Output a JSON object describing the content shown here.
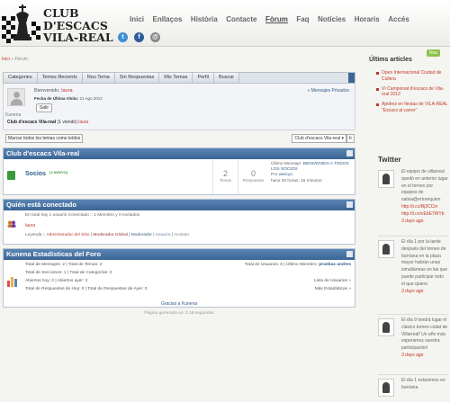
{
  "header": {
    "logo_line1": "CLUB",
    "logo_line2": "D'ESCACS",
    "logo_line3": "VILA-REAL",
    "nav": [
      "Inici",
      "Enllaços",
      "Història",
      "Contacte",
      "Fòrum",
      "Faq",
      "Notícies",
      "Horaris",
      "Accés"
    ],
    "social": [
      "t",
      "f",
      "@"
    ]
  },
  "breadcrumb": {
    "home": "Inici",
    "sep": "»",
    "current": "Fòrum"
  },
  "forum": {
    "tabs": [
      "Categories",
      "Temes Recients",
      "Nou Tema",
      "Sin Respuestas",
      "Mis Temas",
      "Perfil",
      "Buscar"
    ],
    "user": {
      "welcome": "Bienvenido,",
      "username": "laura",
      "last_visit_label": "Fecha de Última Visita:",
      "last_visit_value": "21 Ago 2012",
      "logout": "Salir",
      "private_messages": "» Mensajes Privados",
      "kunena": "Kunena",
      "viewing_prefix": "Club d'escacs Vila-real",
      "viewing_mid": "(1 viendo)",
      "viewing_user": "laura"
    },
    "toolbar": {
      "mark_all": "Marcar todos los temas como leídos",
      "select": "Club d'escacs Vila-real ▾",
      "go": "Ir"
    },
    "category": {
      "section_title": "Club d'escacs Vila-real",
      "name": "Socios",
      "new_badge": "(2 NUEVO)",
      "topics_num": "2",
      "topics_lbl": "Temas",
      "replies_num": "0",
      "replies_lbl": "Respuestas",
      "last_post_label": "Último Mensaje:",
      "last_post_title": "BIENVENIDA A TODOS LOS SOCIOS",
      "by_label": "Por",
      "by_user": "aescyo",
      "time_ago": "hace 20 horas, 15 minutos"
    },
    "online": {
      "section_title": "Quién está conectado",
      "summary": "En total hay 1 usuario Conectado  ::  1 Miembro y 0 Invitados",
      "user": "laura",
      "legend_label": "Leyenda ::",
      "legend_admin": "Administrador del Sitio",
      "legend_gmod": "Moderador Global",
      "legend_mod": "Moderador",
      "legend_user": "Usuario",
      "legend_guest": "Invitado"
    },
    "stats": {
      "section_title": "Kunena Estadísticas del Foro",
      "row1": "Total de Mensajes: 2  |  Total de Temas: 2",
      "row2": "Total de Secciones: 1  |  Total de Categorías: 2",
      "row3": "Abiertos hoy: 0  |  Abiertos ayer: 2",
      "row4": "Total de Respuestas de Hoy: 0  |  Total de Respuestas de Ayer: 0",
      "users_total": "Total de Usuarios: 6  |  Último Miembro:",
      "last_member": "pruebas andres",
      "user_list": "Lista de Usuarios »",
      "more_stats": "Más Estadísticas »"
    },
    "footer_credit": "Gracias a Kunena",
    "footer_time": "Página generada en: 0.18 segundos"
  },
  "sidebar": {
    "articles_title": "Últims articles",
    "new_badge": "Nou",
    "articles": [
      "Open Internacional Ciudad de Cullera",
      "VI Campionat d'escacs de Vila-real 2012",
      "Ajedrez en fiestas de VILA-REAL \"Escacs al carrer\""
    ],
    "twitter_title": "Twitter",
    "tweets": [
      {
        "text": "El equipo de villarreal quedó en anterior lugar en el torneo por equipos de xativa@ertorequien",
        "link": "http://t.co/Bj3CCin http://t.co/vEbE7WYb",
        "date": "3 days ago"
      },
      {
        "text": "El día 1 por la tarde después del torneo de burriana en la plaza mayor habrán unas simultáneas en las que puede participar todo el que quiera",
        "link": "",
        "date": "3 days ago"
      },
      {
        "text": "El día 9 tendrá lugar el clásico torneo ciutat de Villarreal! Un año más esperamos vuestra participación!",
        "link": "",
        "date": "3 days ago"
      },
      {
        "text": "El día 1 estaremos en burriana",
        "link": "",
        "date": ""
      }
    ]
  },
  "colors": {
    "accent_red": "#c0392b",
    "header_blue": "#3a6596",
    "link_blue": "#2f5d8a"
  }
}
